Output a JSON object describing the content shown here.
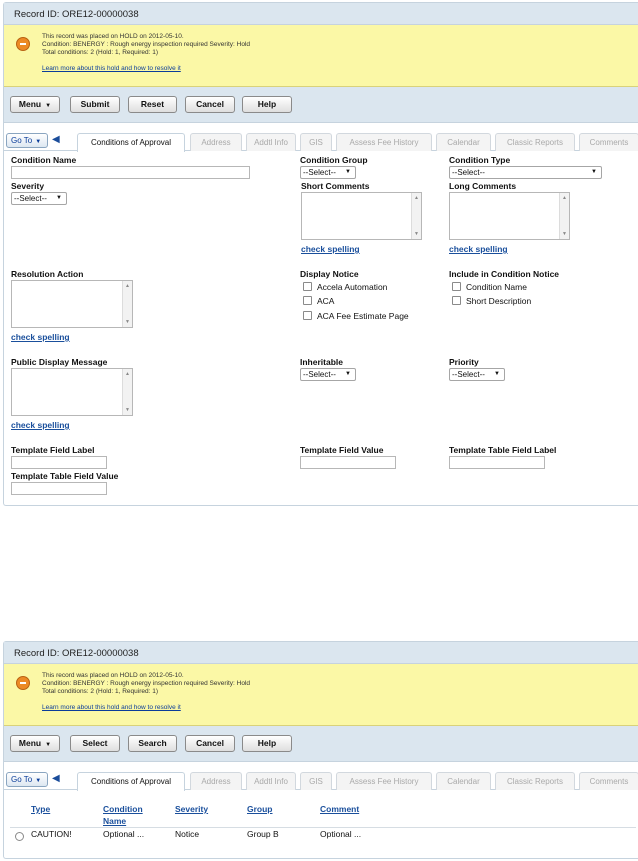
{
  "record_id": "Record ID: ORE12-00000038",
  "hold": {
    "line1": "This record was placed on HOLD on 2012-05-10.",
    "line2": "Condition: BENERGY : Rough energy inspection required Severity: Hold",
    "line3": "Total conditions: 2   (Hold: 1, Required: 1)",
    "link": "Learn more about this hold and how to resolve it"
  },
  "toolbar1": {
    "menu": "Menu",
    "submit": "Submit",
    "reset": "Reset",
    "cancel": "Cancel",
    "help": "Help"
  },
  "toolbar2": {
    "menu": "Menu",
    "select": "Select",
    "search": "Search",
    "cancel": "Cancel",
    "help": "Help"
  },
  "goto": "Go To",
  "tabs": [
    "Conditions of Approval",
    "Address",
    "Addtl Info",
    "GIS",
    "Assess Fee History",
    "Calendar",
    "Classic Reports",
    "Comments"
  ],
  "form": {
    "condition_name": "Condition Name",
    "condition_group": "Condition Group",
    "condition_type": "Condition Type",
    "severity": "Severity",
    "short_comments": "Short Comments",
    "long_comments": "Long Comments",
    "resolution_action": "Resolution Action",
    "display_notice": "Display Notice",
    "include_notice": "Include in Condition Notice",
    "public_display_message": "Public Display Message",
    "inheritable": "Inheritable",
    "priority": "Priority",
    "template_field_label": "Template Field Label",
    "template_field_value": "Template Field Value",
    "template_table_field_label": "Template Table Field Label",
    "template_table_field_value": "Template Table Field Value",
    "select_placeholder": "--Select--",
    "check_spelling": "check spelling",
    "display_notice_options": [
      "Accela Automation",
      "ACA",
      "ACA Fee Estimate Page"
    ],
    "include_notice_options": [
      "Condition Name",
      "Short Description"
    ]
  },
  "table": {
    "headers": {
      "type": "Type",
      "condition_name": "Condition",
      "condition_name_2": "Name",
      "severity": "Severity",
      "group": "Group",
      "comment": "Comment"
    },
    "rows": [
      {
        "type": "CAUTION!",
        "condition_name": "Optional ...",
        "severity": "Notice",
        "group": "Group B",
        "comment": "Optional ..."
      }
    ]
  },
  "colors": {
    "header_bg": "#dbe6ef",
    "hold_bg": "#fbf8a6",
    "hold_icon": "#ec8a24",
    "link": "#1a4f9c"
  }
}
